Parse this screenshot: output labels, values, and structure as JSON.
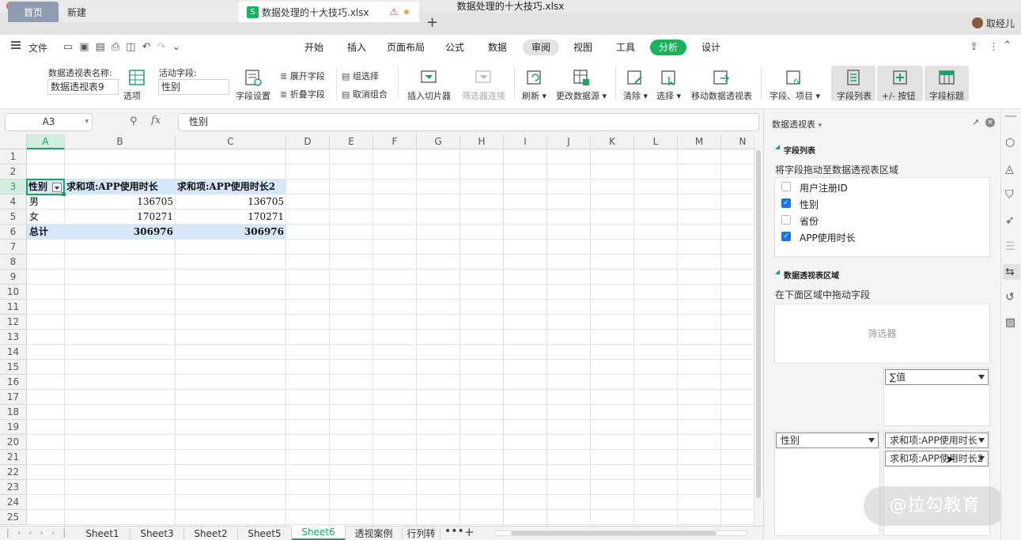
{
  "window": {
    "title": "数据处理的十大技巧.xlsx"
  },
  "tabs": {
    "home": "首页",
    "new": "新建",
    "doc": "数据处理的十大技巧.xlsx",
    "user": "取经儿"
  },
  "menu": {
    "file": "文件",
    "items": [
      "开始",
      "插入",
      "页面布局",
      "公式",
      "数据",
      "审阅",
      "视图",
      "工具",
      "分析",
      "设计"
    ]
  },
  "ribbon": {
    "pivot_name_label": "数据透视表名称:",
    "pivot_name_value": "数据透视表9",
    "options": "选项",
    "active_field_label": "活动字段:",
    "active_field_value": "性别",
    "field_settings": "字段设置",
    "expand_field": "展开字段",
    "collapse_field": "折叠字段",
    "group_select": "组选择",
    "ungroup": "取消组合",
    "insert_slicer": "插入切片器",
    "filter_connections": "筛选器连接",
    "refresh": "刷新",
    "change_source": "更改数据源",
    "clear": "清除",
    "select": "选择",
    "move_pivot": "移动数据透视表",
    "fields_items": "字段、项目",
    "field_list": "字段列表",
    "plus_minus": "+/- 按钮",
    "field_headers": "字段标题"
  },
  "formula": {
    "cell_ref": "A3",
    "fx": "fx",
    "value": "性别"
  },
  "grid": {
    "columns": [
      "A",
      "B",
      "C",
      "D",
      "E",
      "F",
      "G",
      "H",
      "I",
      "J",
      "K",
      "L",
      "M",
      "N"
    ],
    "rows": [
      "1",
      "2",
      "3",
      "4",
      "5",
      "6",
      "7",
      "8",
      "9",
      "10",
      "11",
      "12",
      "13",
      "14",
      "15",
      "16",
      "17",
      "18",
      "19",
      "20",
      "21",
      "22",
      "23",
      "24",
      "25"
    ],
    "header": [
      "性别",
      "求和项:APP使用时长",
      "求和项:APP使用时长2"
    ],
    "data": [
      [
        "男",
        "136705",
        "136705"
      ],
      [
        "女",
        "170271",
        "170271"
      ]
    ],
    "total": [
      "总计",
      "306976",
      "306976"
    ]
  },
  "sheets": [
    "Sheet1",
    "Sheet3",
    "Sheet2",
    "Sheet5",
    "Sheet6",
    "透视案例",
    "行列转"
  ],
  "active_sheet": "Sheet6",
  "panel": {
    "title": "数据透视表",
    "field_list_title": "字段列表",
    "drag_hint": "将字段拖动至数据透视表区域",
    "fields": [
      {
        "label": "用户注册ID",
        "checked": false
      },
      {
        "label": "性别",
        "checked": true
      },
      {
        "label": "省份",
        "checked": false
      },
      {
        "label": "APP使用时长",
        "checked": true
      }
    ],
    "area_title": "数据透视表区域",
    "area_hint": "在下面区域中拖动字段",
    "filter_label": "筛选器",
    "values_label": "∑值",
    "row_field": "性别",
    "value_fields": [
      "求和项:APP使用时长",
      "求和项:APP使用时长2"
    ]
  },
  "watermark": "@拉勾教育",
  "colors": {
    "accent_green": "#19b35c",
    "selection_blue": "#d6e8f8",
    "checkbox_blue": "#1a73e8"
  }
}
